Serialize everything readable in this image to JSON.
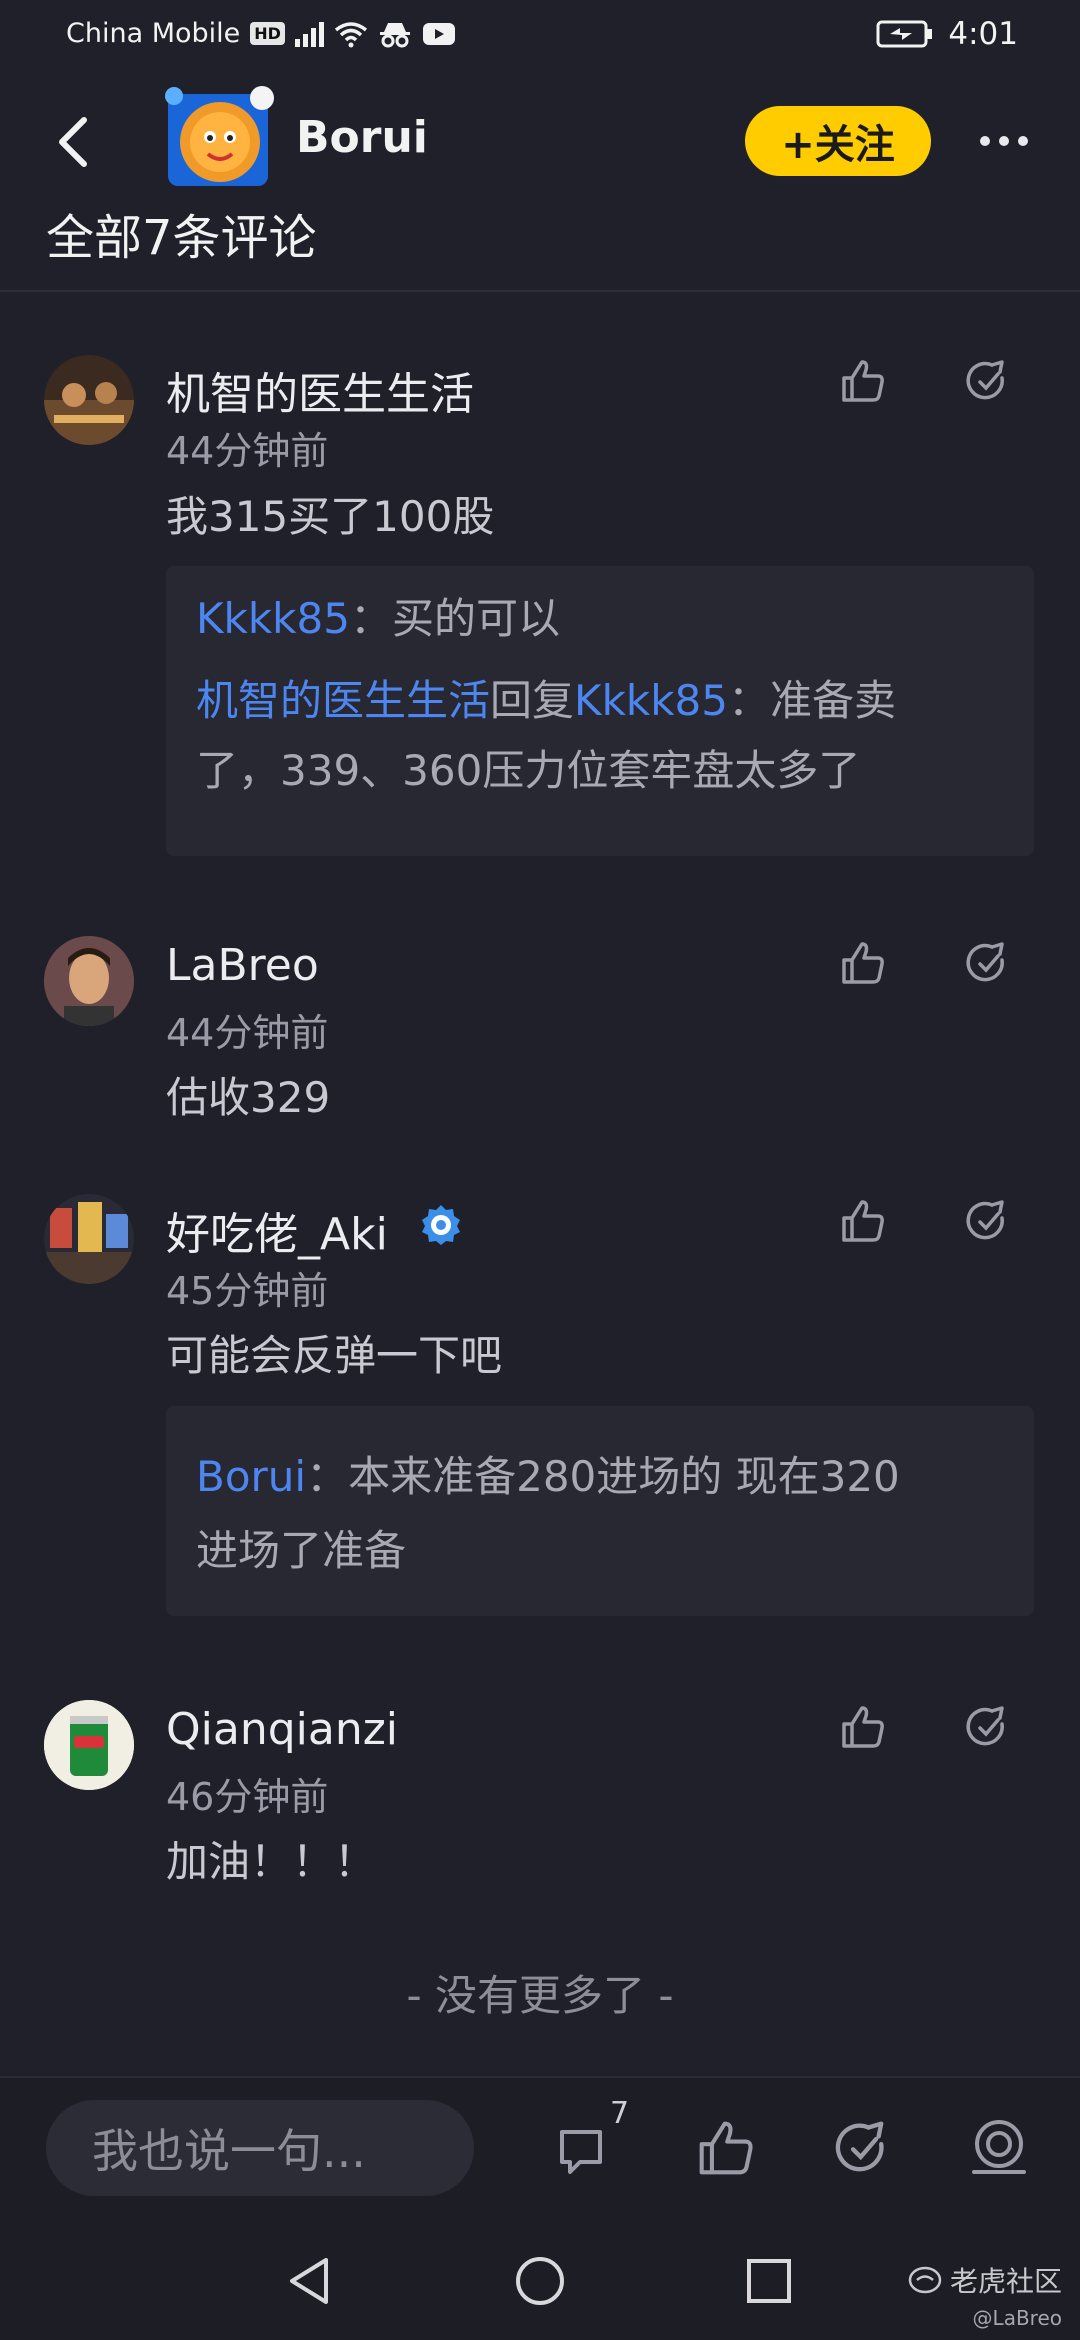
{
  "status_bar": {
    "carrier": "China Mobile",
    "hd": "HD",
    "time": "4:01"
  },
  "header": {
    "name": "Borui",
    "follow_label": "+关注",
    "all_comments": "全部7条评论"
  },
  "comments": [
    {
      "name": "机智的医生生活",
      "time": "44分钟前",
      "text": "我315买了100股",
      "replies": [
        {
          "author": "Kkkk85",
          "sep": "：",
          "text": "买的可以"
        },
        {
          "author": "机智的医生生活",
          "reply_word": "回复",
          "reply_to": "Kkkk85",
          "sep": "：",
          "text_line1": "准备卖",
          "text_line2": "了，339、360压力位套牢盘太多了"
        }
      ]
    },
    {
      "name": "LaBreo",
      "time": "44分钟前",
      "text": "估收329"
    },
    {
      "name": "好吃佬_Aki",
      "time": "45分钟前",
      "text": "可能会反弹一下吧",
      "replies": [
        {
          "author": "Borui",
          "sep": "：",
          "text_line1": "本来准备280进场的 现在320",
          "text_line2": "进场了准备"
        }
      ]
    },
    {
      "name": "Qianqianzi",
      "time": "46分钟前",
      "text": "加油！！！"
    }
  ],
  "no_more": "- 没有更多了 -",
  "bottom": {
    "input_placeholder": "我也说一句...",
    "comment_count": "7"
  },
  "watermark": {
    "brand": "老虎社区",
    "user": "@LaBreo"
  },
  "colors": {
    "background": "#1f2029",
    "accent_yellow": "#ffcc00",
    "link_blue": "#4d86f0"
  }
}
